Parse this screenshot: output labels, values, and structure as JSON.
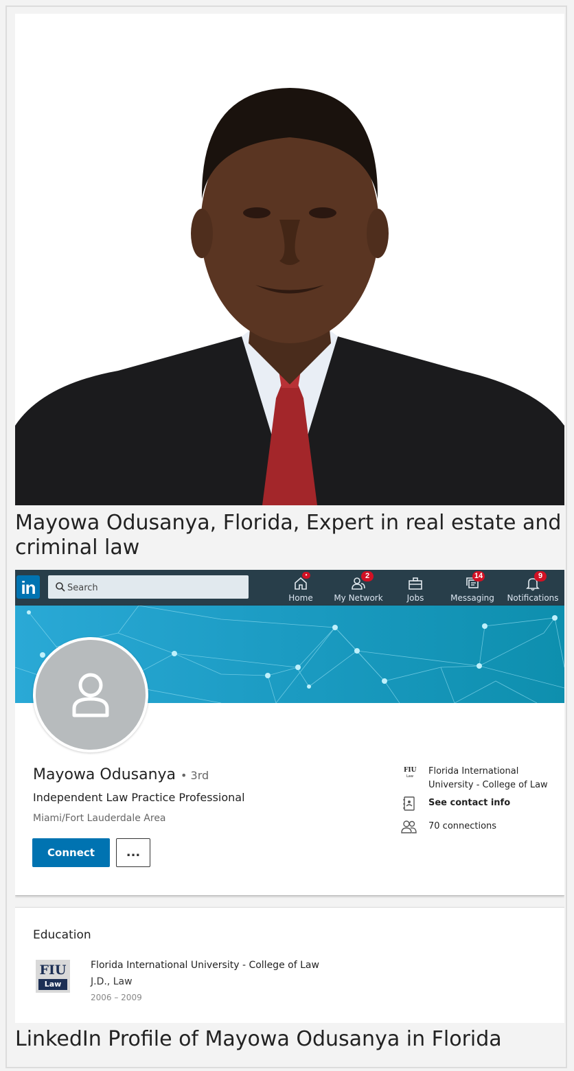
{
  "captions": {
    "top": "Mayowa Odusanya, Florida, Expert in real estate and criminal law",
    "bottom": "LinkedIn Profile of Mayowa Odusanya in Florida"
  },
  "nav": {
    "logo": "in",
    "search_placeholder": "Search",
    "items": [
      {
        "label": "Home",
        "icon": "home-icon",
        "badge": "•"
      },
      {
        "label": "My Network",
        "icon": "network-icon",
        "badge": "2"
      },
      {
        "label": "Jobs",
        "icon": "briefcase-icon",
        "badge": ""
      },
      {
        "label": "Messaging",
        "icon": "messaging-icon",
        "badge": "14"
      },
      {
        "label": "Notifications",
        "icon": "bell-icon",
        "badge": "9"
      }
    ]
  },
  "profile": {
    "name": "Mayowa Odusanya",
    "degree": "• 3rd",
    "headline": "Independent Law Practice Professional",
    "location": "Miami/Fort Lauderdale Area",
    "connect_label": "Connect",
    "more_label": "...",
    "side": {
      "school": "Florida International University - College of Law",
      "school_logo_text": "FIU",
      "school_logo_sub": "Law",
      "contact": "See contact info",
      "connections": "70 connections"
    }
  },
  "education": {
    "title": "Education",
    "logo_text": "FIU",
    "logo_sub": "Law",
    "school": "Florida International University - College of Law",
    "degree": "J.D., Law",
    "dates": "2006 – 2009"
  },
  "colors": {
    "nav_bg": "#283e4a",
    "brand": "#0073b1",
    "badge": "#d11124",
    "banner": "#1a9cbf"
  }
}
